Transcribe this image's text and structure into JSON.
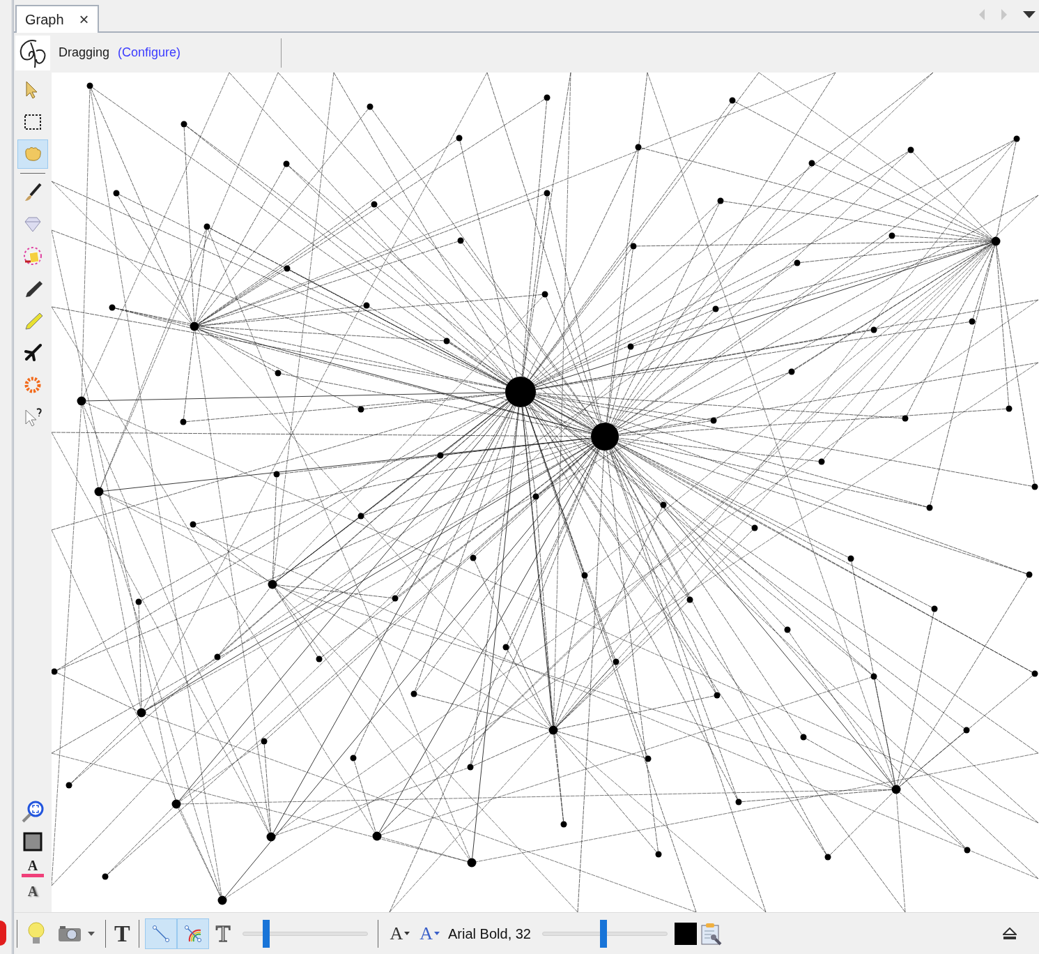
{
  "tab": {
    "label": "Graph",
    "close": "×",
    "selected": true
  },
  "toolbar": {
    "mode": "Dragging",
    "configure_link": "(Configure)"
  },
  "left_tools": [
    {
      "selected": false
    },
    {
      "selected": false
    },
    {
      "selected": true
    },
    {
      "selected": false
    },
    {
      "selected": false
    },
    {
      "selected": false
    },
    {
      "selected": false
    },
    {
      "selected": false
    },
    {
      "selected": false
    },
    {
      "selected": false
    },
    {
      "selected": false
    }
  ],
  "left_bottom_tools": {
    "label_color_glyph": "A",
    "label_font_glyph": "A"
  },
  "bottom_toolbar": {
    "text_bold_glyph": "T",
    "edge_buttons": [
      {
        "selected": true
      },
      {
        "selected": true
      }
    ],
    "text_outline_glyph": "T",
    "edge_scale": {
      "level": 0.17
    },
    "font_glyphs": [
      "A",
      "A"
    ],
    "font_label": "Arial Bold, 32",
    "font_scale": {
      "level": 0.49
    }
  }
}
